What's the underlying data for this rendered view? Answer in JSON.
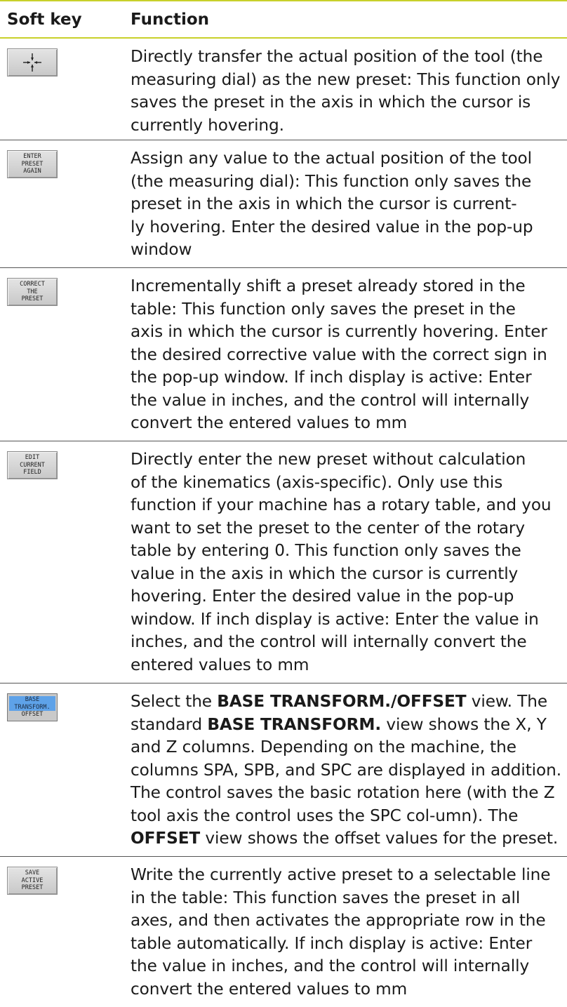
{
  "header": {
    "softkey_col": "Soft key",
    "function_col": "Function"
  },
  "rows": [
    {
      "softkey_lines": [],
      "softkey_icon": "crosshair-icon",
      "description": "Directly transfer the actual position of the tool (the measuring dial) as the new preset: This function only saves the preset in the axis in which the cursor is currently hovering."
    },
    {
      "softkey_lines": [
        "ENTER",
        "PRESET",
        "AGAIN"
      ],
      "description_lines": [
        "Assign any value to the actual position of the tool",
        "(the measuring dial): This function only saves the",
        "preset in the axis in which the cursor is current-",
        "ly hovering. Enter the desired value in the pop-up",
        "window"
      ]
    },
    {
      "softkey_lines": [
        "CORRECT",
        "THE",
        "PRESET"
      ],
      "description_lines": [
        "Incrementally shift a preset already stored in the",
        "table: This function only saves the preset in the",
        "axis in which the cursor is currently hovering. Enter",
        "the desired corrective value with the correct sign in",
        "the pop-up window. If inch display is active: Enter",
        "the value in inches, and the control will internally",
        "convert the entered values to mm"
      ]
    },
    {
      "softkey_lines": [
        "EDIT",
        "CURRENT",
        "FIELD"
      ],
      "description_lines": [
        "Directly enter the new preset without calculation",
        "of the kinematics (axis-specific). Only use this",
        "function if your machine has a rotary table, and you",
        "want to set the preset to the center of the rotary",
        "table by entering 0. This function only saves the",
        "value in the axis in which the cursor is currently",
        "hovering. Enter the desired value in the pop-up",
        "window. If inch display is active: Enter the value in",
        "inches, and the control will internally convert the",
        "entered values to mm"
      ]
    },
    {
      "softkey_lines": [
        "BASE",
        "TRANSFORM.",
        "OFFSET"
      ],
      "softkey_active": true,
      "description_parts": {
        "p1": "Select the ",
        "b1": "BASE TRANSFORM./OFFSET",
        "p2": " view. The standard ",
        "b2": "BASE TRANSFORM.",
        "p3": " view shows the X, Y and Z columns. Depending on the machine, the columns SPA, SPB, and SPC are displayed in addition. The control saves the basic rotation here (with the Z tool axis the control uses the SPC col-umn). The ",
        "b3": "OFFSET",
        "p4": " view shows the offset values for the preset."
      }
    },
    {
      "softkey_lines": [
        "SAVE",
        "ACTIVE",
        "PRESET"
      ],
      "description_lines": [
        "Write the currently active preset to a selectable line",
        "in the table: This function saves the preset in all",
        "axes, and then activates the appropriate row in the",
        "table automatically. If inch display is active: Enter",
        "the value in inches, and the control will internally",
        "convert the entered values to mm"
      ]
    }
  ],
  "colors": {
    "header_rule": "#c8d02a",
    "highlight": "#5ea2e8"
  }
}
